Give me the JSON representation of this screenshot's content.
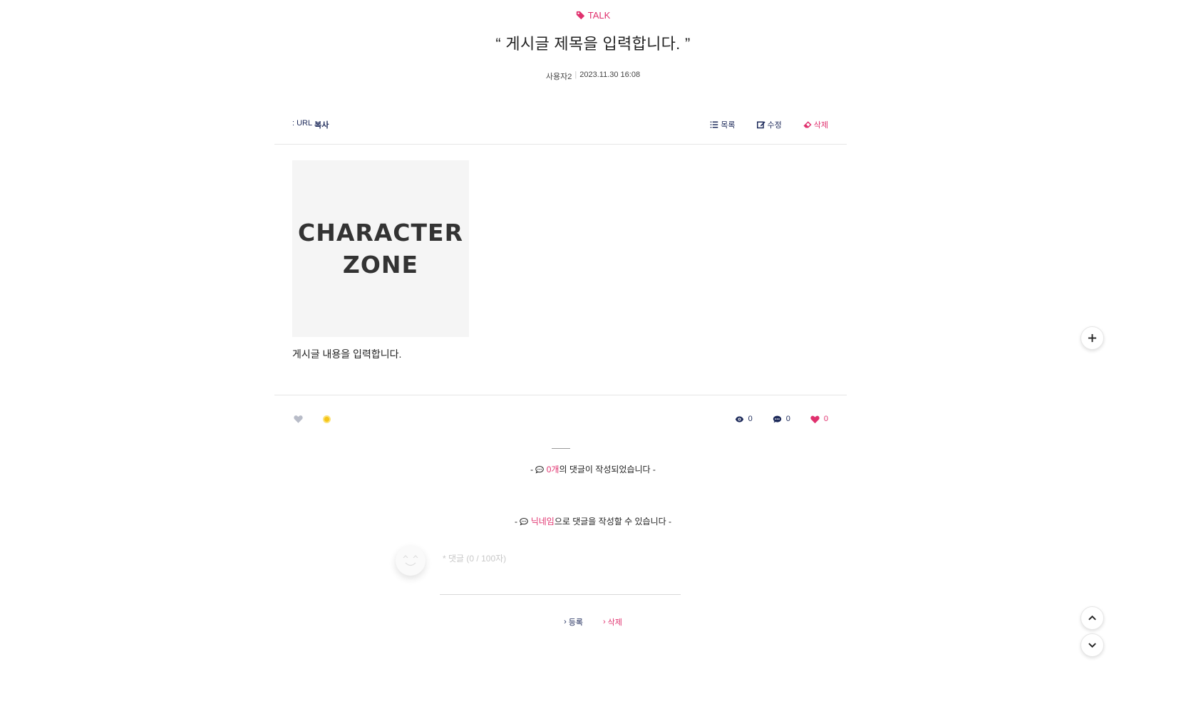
{
  "post": {
    "category": "TALK",
    "title": "“ 게시글 제목을 입력합니다. ”",
    "author": "사용자2",
    "datetime": "2023.11.30 16:08",
    "content": "게시글 내용을 입력합니다.",
    "image_text": [
      "CHARACTER",
      "ZONE"
    ]
  },
  "toolbar": {
    "url_prefix": ": URL",
    "url_label": "복사",
    "list_label": "목록",
    "edit_label": "수정",
    "delete_label": "삭제"
  },
  "stats": {
    "views": "0",
    "comments": "0",
    "likes": "0"
  },
  "comments": {
    "count_prefix": "- ",
    "count_value": "0개",
    "count_suffix": "의 댓글이 작성되었습니다 -",
    "nick_prefix": "- ",
    "nick_value": "닉네임",
    "nick_suffix": "으로 댓글을 작성할 수 있습니다 -",
    "input_placeholder": "* 댓글 (0 / 100자)",
    "submit_label": "등록",
    "delete_label": "삭제"
  },
  "colors": {
    "accent": "#e0316e",
    "navy": "#1d2a5a",
    "dot": "#f5c518"
  },
  "icons": {
    "category": "tag-icon",
    "list": "list-icon",
    "edit": "edit-icon",
    "delete": "eraser-icon",
    "views": "eye-icon",
    "comments": "comment-icon",
    "likes": "heart-icon",
    "float_add": "plus-icon",
    "scroll_top": "chevron-up-icon",
    "scroll_bottom": "chevron-down-icon"
  }
}
